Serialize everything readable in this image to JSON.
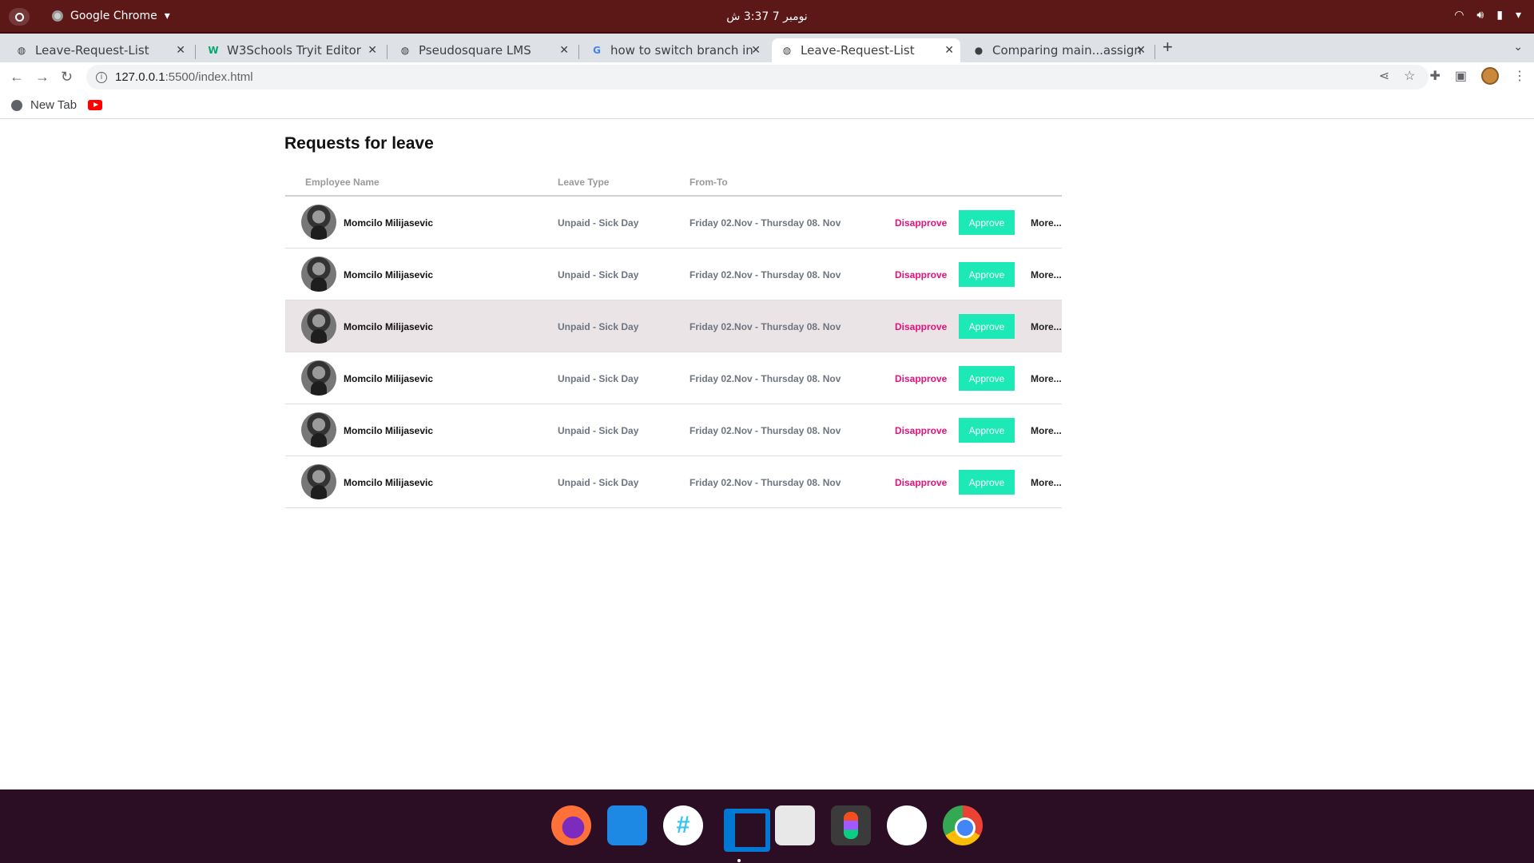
{
  "system": {
    "app_name": "Google Chrome",
    "clock": "نومبر 7  3:37 ش"
  },
  "tabs": [
    {
      "title": "Leave-Request-List",
      "active": false,
      "icon": "globe-icon"
    },
    {
      "title": "W3Schools Tryit Editor",
      "active": false,
      "icon": "w3schools-icon"
    },
    {
      "title": "Pseudosquare LMS",
      "active": false,
      "icon": "globe-icon"
    },
    {
      "title": "how to switch branch in g",
      "active": false,
      "icon": "google-icon"
    },
    {
      "title": "Leave-Request-List",
      "active": true,
      "icon": "globe-icon"
    },
    {
      "title": "Comparing main...assignm",
      "active": false,
      "icon": "github-icon"
    }
  ],
  "address_bar": {
    "host": "127.0.0.1",
    "path": ":5500/index.html"
  },
  "bookmarks": {
    "new_tab": "New Tab"
  },
  "page": {
    "title": "Requests for leave",
    "columns": [
      "Employee Name",
      "Leave Type",
      "From-To"
    ],
    "rows": [
      {
        "name": "Momcilo Milijasevic",
        "leave_type": "Unpaid - Sick Day",
        "dates": "Friday 02.Nov - Thursday 08. Nov",
        "highlighted": false
      },
      {
        "name": "Momcilo Milijasevic",
        "leave_type": "Unpaid - Sick Day",
        "dates": "Friday 02.Nov - Thursday 08. Nov",
        "highlighted": false
      },
      {
        "name": "Momcilo Milijasevic",
        "leave_type": "Unpaid - Sick Day",
        "dates": "Friday 02.Nov - Thursday 08. Nov",
        "highlighted": true
      },
      {
        "name": "Momcilo Milijasevic",
        "leave_type": "Unpaid - Sick Day",
        "dates": "Friday 02.Nov - Thursday 08. Nov",
        "highlighted": false
      },
      {
        "name": "Momcilo Milijasevic",
        "leave_type": "Unpaid - Sick Day",
        "dates": "Friday 02.Nov - Thursday 08. Nov",
        "highlighted": false
      },
      {
        "name": "Momcilo Milijasevic",
        "leave_type": "Unpaid - Sick Day",
        "dates": "Friday 02.Nov - Thursday 08. Nov",
        "highlighted": false
      }
    ],
    "actions": {
      "disapprove": "Disapprove",
      "approve": "Approve",
      "more": "More..."
    }
  },
  "colors": {
    "topbar": "#5c1717",
    "disapprove": "#e3127a",
    "approve_bg": "#1de9b6",
    "row_highlight": "#ebe4e7",
    "dock": "#2b0d24"
  },
  "dock": [
    "firefox-icon",
    "files-icon",
    "slack-icon",
    "vscode-icon",
    "software-store-icon",
    "figma-icon",
    "android-studio-icon",
    "chrome-icon"
  ]
}
